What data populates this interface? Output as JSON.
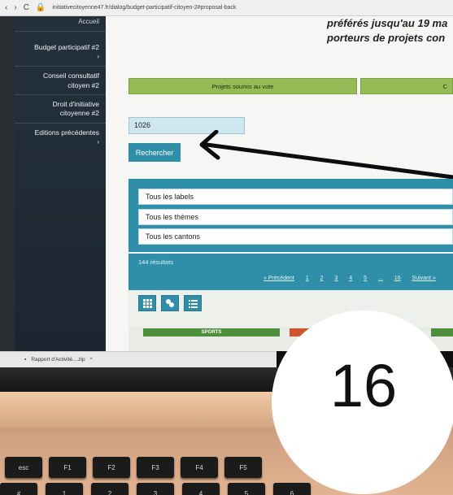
{
  "browser": {
    "nav": [
      "‹",
      "›",
      "C"
    ],
    "url": "initiativecitoyenne47.fr/dialog/budget-participatif-citoyen-2#proposal-back"
  },
  "sidebar": {
    "items": [
      {
        "label": "Accueil"
      },
      {
        "label": "Budget participatif #2",
        "arrow": "›"
      },
      {
        "label": "Conseil consultatif citoyen #2"
      },
      {
        "label": "Droit d'initiative citoyenne #2"
      },
      {
        "label": "Editions précédentes",
        "arrow": "›"
      }
    ]
  },
  "headline": {
    "line1": "préférés jusqu'au 19 ma",
    "line2": "porteurs de projets con"
  },
  "tabs": {
    "voted": "Projets soumis au vote",
    "second": "C"
  },
  "search": {
    "value": "1026",
    "button": "Rechercher"
  },
  "filters": {
    "labels": "Tous les labels",
    "themes": "Tous les thèmes",
    "cantons": "Tous les cantons"
  },
  "results": {
    "count": "144 résultats",
    "prev": "« Précédent",
    "pages": [
      "1",
      "2",
      "3",
      "4",
      "5",
      "...",
      "16"
    ],
    "next": "Suivant »"
  },
  "cards": {
    "tag1": "SPORTS"
  },
  "download": {
    "file": "Rapport d'Activité....zip",
    "chevron": "^"
  },
  "overlay": {
    "number": "16"
  },
  "keyboard": {
    "esc": "esc",
    "f1": "F1",
    "f2": "F2",
    "f3": "F3",
    "f4": "F4",
    "f5": "F5",
    "tilde": "#",
    "n1": "1",
    "n2": "2",
    "n3": "3",
    "n4": "4",
    "n5": "5",
    "n6": "6"
  },
  "colors": {
    "sidebar": "#24313d",
    "accent": "#2f8ea8",
    "green_tab": "#95bb57"
  }
}
